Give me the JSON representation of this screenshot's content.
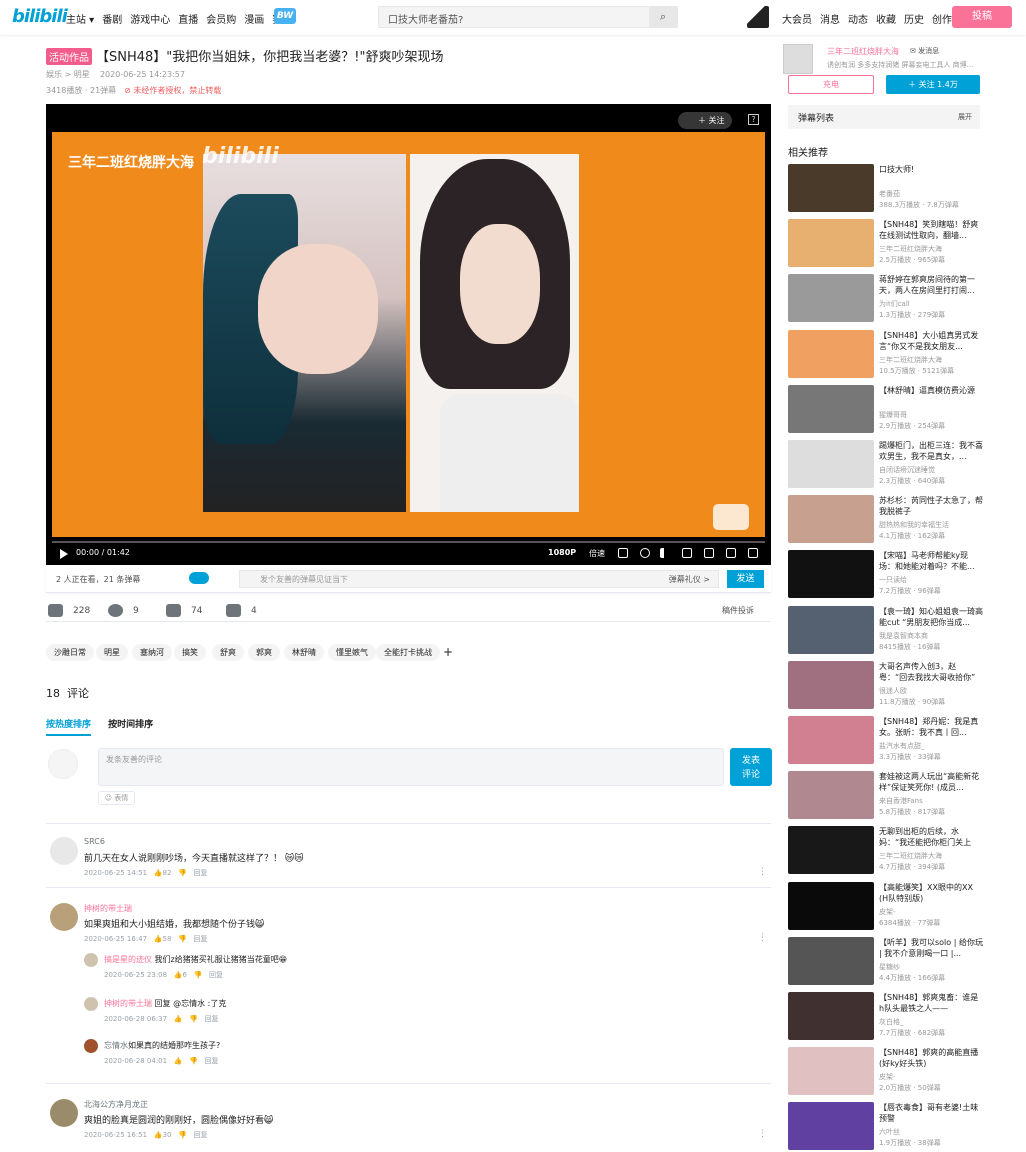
{
  "header": {
    "logo": "bilibili",
    "nav": [
      "主站 ▾",
      "番剧",
      "游戏中心",
      "直播",
      "会员购",
      "漫画",
      "赛事"
    ],
    "bw": "BW",
    "search_placeholder": "口技大师老番茄?",
    "right_nav": [
      "大会员",
      "消息",
      "动态",
      "收藏",
      "历史",
      "创作中心"
    ],
    "upload": "投稿"
  },
  "video": {
    "tag": "活动作品",
    "title": "【SNH48】\"我把你当姐妹，你把我当老婆？!\"舒爽吵架现场",
    "category": "娱乐 > 明星",
    "date": "2020-06-25 14:23:57",
    "views": "3418播放 · 21弹幕",
    "warning": "未经作者授权，禁止转载",
    "overlay_title": "三年二班红烧胖大海",
    "overlay_logo": "bilibili",
    "follow_label": "＋ 关注",
    "time": "00:00 / 01:42",
    "quality": "1080P",
    "speed": "倍速"
  },
  "danmaku_bar": {
    "count": "2 人正在看，21 条弹幕",
    "placeholder": "发个友善的弹幕见证当下",
    "etiquette": "弹幕礼仪 >",
    "send": "发送"
  },
  "stats": {
    "like": "228",
    "coin": "9",
    "fav": "74",
    "share": "4",
    "report": "稿件投诉"
  },
  "tags": [
    "沙雕日常",
    "明星",
    "塞纳河",
    "搞笑",
    "舒爽",
    "郭爽",
    "林舒晴",
    "懂里嫉气",
    "全能打卡挑战"
  ],
  "comments_header": {
    "count": "18",
    "label": "评论",
    "sort_hot": "按热度排序",
    "sort_time": "按时间排序",
    "placeholder": "发条友善的评论",
    "emoji": "☺ 表情",
    "submit": "发表\n评论"
  },
  "comments": [
    {
      "user": "SRC6",
      "text": "前几天在女人说刚刚吵场，今天直播就这样了？！ 😿😿",
      "date": "2020-06-25 14:51",
      "likes": "82",
      "reply": "回复"
    },
    {
      "user": "抻树的带土瑞",
      "text": "如果爽姐和大小姐结婚，我都想随个份子钱😸",
      "date": "2020-06-25 16:47",
      "likes": "58",
      "reply": "回复",
      "replies": [
        {
          "user": "搞是星的迹仪",
          "text": "我们z给猪猪买礼服让猪猪当花童吧😁",
          "date": "2020-06-25 23:08",
          "likes": "6",
          "reply": "回复"
        },
        {
          "user": "抻树的带土瑞",
          "text": "回复 @忘情水 :了克",
          "date": "2020-06-28 06:37",
          "likes": "",
          "reply": "回复"
        },
        {
          "user": "忘情水",
          "text": "如果真的结婚那咋生孩子?",
          "date": "2020-06-28 04:01",
          "likes": "",
          "reply": "回复"
        }
      ]
    },
    {
      "user": "北海公方净月龙正",
      "text": "爽姐的脸真是圆润的刚刚好，圆脸偶像好好看😸",
      "date": "2020-06-25 16:51",
      "likes": "30",
      "reply": "回复"
    }
  ],
  "uploader": {
    "name": "三年二班红烧胖大海",
    "message": "发消息",
    "desc": "诱创有润 多多支持润猪 屏幕妄电工具人 商博...",
    "charge": "充电",
    "follow": "＋ 关注 1.4万"
  },
  "danmaku_list": {
    "title": "弹幕列表",
    "expand": "展开"
  },
  "related_title": "相关推荐",
  "related": [
    {
      "title": "口技大师!",
      "owner": "老番茄",
      "stats": "388.3万播放 · 7.8万弹幕"
    },
    {
      "title": "【SNH48】笑到瞎喵！舒爽在线测试性取向，翻墙...",
      "owner": "三年二班红烧胖大海",
      "stats": "2.5万播放 · 965弹幕"
    },
    {
      "title": "蒋舒婷在郭爽房间待的第一天，两人在房间里打打闹...",
      "owner": "为it们call",
      "stats": "1.3万播放 · 279弹幕"
    },
    {
      "title": "【SNH48】大小姐真男式发言“你又不是我女朋友...",
      "owner": "三年二班红烧胖大海",
      "stats": "10.5万播放 · 5121弹幕"
    },
    {
      "title": "【林舒晴】逼真模仿费沁源",
      "owner": "猩爆哥哥",
      "stats": "2.9万播放 · 254弹幕"
    },
    {
      "title": "踢爆柜门，出柜三连：我不喜欢男生，我不是真女，...",
      "owner": "自闭话痨沉迷睡觉",
      "stats": "2.3万播放 · 640弹幕"
    },
    {
      "title": "苏杉杉：芮同性子太急了，帮我脱裤子",
      "owner": "甜热热和我的幸福生活",
      "stats": "4.1万播放 · 162弹幕"
    },
    {
      "title": "【宋喵】马老师帮能ky现场：和她能对着吗？不能...",
      "owner": "一只读给",
      "stats": "7.2万播放 · 96弹幕"
    },
    {
      "title": "【袁一琦】知心姐姐袁一琦高能cut “男朋友把你当成...",
      "owner": "我是袁智商本商",
      "stats": "8415播放 · 16弹幕"
    },
    {
      "title": "大哥名声传入创3，赵粤：“回去我找大哥收拾你”",
      "owner": "很迷人欧",
      "stats": "11.8万播放 · 90弹幕"
    },
    {
      "title": "【SNH48】郑丹妮：我是真女。张昕：我不真丨回...",
      "owner": "盐汽水有点甜_",
      "stats": "3.3万播放 · 33弹幕"
    },
    {
      "title": "套娃被这两人玩出“高能新花样”保证笑死你! (成员...",
      "owner": "来自香港Fans",
      "stats": "5.8万播放 · 817弹幕"
    },
    {
      "title": "无聊到出柜的后续，水妈：“我还能把你柜门关上吗？”",
      "owner": "三年二班红烧胖大海",
      "stats": "4.7万播放 · 394弹幕"
    },
    {
      "title": "【高能爆笑】XX眼中的XX (H队特别版)",
      "owner": "皮架-",
      "stats": "6384播放 · 77弹幕"
    },
    {
      "title": "【听羊】我可以solo | 给你玩 | 我不介意刚喝一口 |...",
      "owner": "星糖纱",
      "stats": "4.4万播放 · 166弹幕"
    },
    {
      "title": "【SNH48】郭爽鬼畜：谁是h队头最铁之人——",
      "owner": "灰白格_",
      "stats": "7.7万播放 · 682弹幕"
    },
    {
      "title": "【SNH48】郭爽的高能直播 (好ky好头铁)",
      "owner": "皮架-",
      "stats": "2.0万播放 · 50弹幕"
    },
    {
      "title": "【唇衣毒食】哥有老婆!土味预警",
      "owner": "六叶丝",
      "stats": "1.9万播放 · 38弹幕"
    }
  ]
}
